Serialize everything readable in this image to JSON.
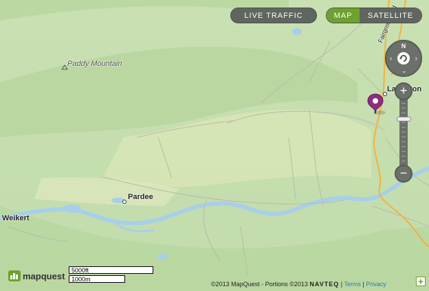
{
  "controls": {
    "live_traffic": "LIVE TRAFFIC",
    "map": "MAP",
    "satellite": "SATELLITE",
    "compass_n": "N",
    "zoom_in": "+",
    "zoom_out": "−",
    "expand": "+"
  },
  "labels": {
    "paddy_mountain": "Paddy Mountain",
    "lewistown": "Laurelton",
    "pardee": "Pardee",
    "weikert": "Weikert",
    "fairground_rd": "Fairground Rd"
  },
  "scale": {
    "feet": "5000ft",
    "meters": "1000m"
  },
  "logo": {
    "text": "mapquest"
  },
  "attribution": {
    "copyright": "©2013 MapQuest  -  Portions ©2013",
    "navteq": "NAVTEQ",
    "sep1": " | ",
    "terms": "Terms",
    "sep2": " | ",
    "privacy": "Privacy"
  },
  "colors": {
    "map_button_active": "#6ea12f",
    "control_gray": "#5f6660",
    "pin": "#8e2c82",
    "water": "#a8cfe8",
    "road_major": "#f2b23a"
  }
}
